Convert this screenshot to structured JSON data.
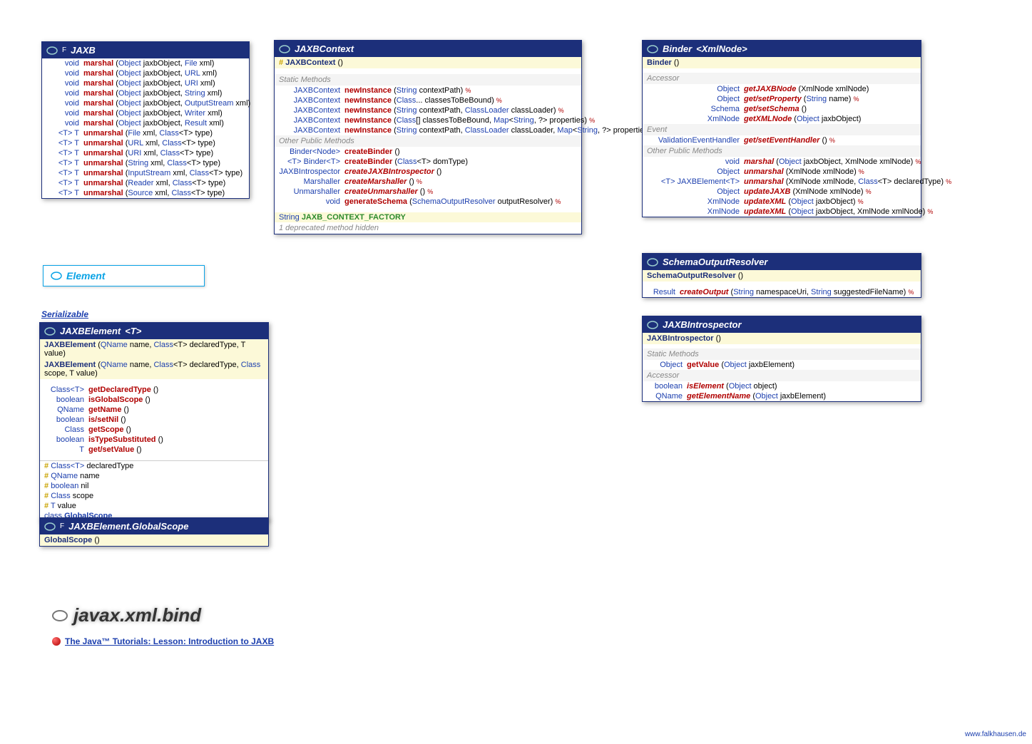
{
  "package": "javax.xml.bind",
  "tutorial": "The Java™ Tutorials: Lesson: Introduction to JAXB",
  "footer": "www.falkhausen.de",
  "element_label": "Element",
  "serializable_label": "Serializable",
  "jaxb": {
    "title_prefix": "F",
    "title": "JAXB",
    "rows": [
      {
        "ret": "void",
        "name": "marshal",
        "params": "(Object jaxbObject, File xml)",
        "link": [
          "Object",
          "File"
        ]
      },
      {
        "ret": "void",
        "name": "marshal",
        "params": "(Object jaxbObject, URL xml)",
        "link": [
          "Object",
          "URL"
        ]
      },
      {
        "ret": "void",
        "name": "marshal",
        "params": "(Object jaxbObject, URI xml)",
        "link": [
          "Object",
          "URI"
        ]
      },
      {
        "ret": "void",
        "name": "marshal",
        "params": "(Object jaxbObject, String xml)",
        "link": [
          "Object",
          "String"
        ]
      },
      {
        "ret": "void",
        "name": "marshal",
        "params": "(Object jaxbObject, OutputStream xml)",
        "link": [
          "Object",
          "OutputStream"
        ]
      },
      {
        "ret": "void",
        "name": "marshal",
        "params": "(Object jaxbObject, Writer xml)",
        "link": [
          "Object",
          "Writer"
        ]
      },
      {
        "ret": "void",
        "name": "marshal",
        "params": "(Object jaxbObject, Result xml)",
        "link": [
          "Object",
          "Result"
        ]
      },
      {
        "ret": "<T> T",
        "name": "unmarshal",
        "params": "(File xml, Class<T> type)",
        "link": [
          "File",
          "Class"
        ]
      },
      {
        "ret": "<T> T",
        "name": "unmarshal",
        "params": "(URL xml, Class<T> type)",
        "link": [
          "URL",
          "Class"
        ]
      },
      {
        "ret": "<T> T",
        "name": "unmarshal",
        "params": "(URI xml, Class<T> type)",
        "link": [
          "URI",
          "Class"
        ]
      },
      {
        "ret": "<T> T",
        "name": "unmarshal",
        "params": "(String xml, Class<T> type)",
        "link": [
          "String",
          "Class"
        ]
      },
      {
        "ret": "<T> T",
        "name": "unmarshal",
        "params": "(InputStream xml, Class<T> type)",
        "link": [
          "InputStream",
          "Class"
        ]
      },
      {
        "ret": "<T> T",
        "name": "unmarshal",
        "params": "(Reader xml, Class<T> type)",
        "link": [
          "Reader",
          "Class"
        ]
      },
      {
        "ret": "<T> T",
        "name": "unmarshal",
        "params": "(Source xml, Class<T> type)",
        "link": [
          "Source",
          "Class"
        ]
      }
    ]
  },
  "jaxbcontext": {
    "title": "JAXBContext",
    "ctor": "JAXBContext",
    "static_lbl": "Static Methods",
    "other_lbl": "Other Public Methods",
    "statics": [
      {
        "ret": "JAXBContext",
        "name": "newInstance",
        "params": "(String contextPath)"
      },
      {
        "ret": "JAXBContext",
        "name": "newInstance",
        "params": "(Class... classesToBeBound)"
      },
      {
        "ret": "JAXBContext",
        "name": "newInstance",
        "params": "(String contextPath, ClassLoader classLoader)"
      },
      {
        "ret": "JAXBContext",
        "name": "newInstance",
        "params": "(Class[] classesToBeBound, Map<String, ?> properties)"
      },
      {
        "ret": "JAXBContext",
        "name": "newInstance",
        "params": "(String contextPath, ClassLoader classLoader, Map<String, ?> properties)"
      }
    ],
    "others": [
      {
        "ret": "Binder<Node>",
        "name": "createBinder",
        "params": "()"
      },
      {
        "ret": "<T> Binder<T>",
        "name": "createBinder",
        "params": "(Class<T> domType)"
      },
      {
        "ret": "JAXBIntrospector",
        "name": "createJAXBIntrospector",
        "params": "()",
        "italic": true
      },
      {
        "ret": "Marshaller",
        "name": "createMarshaller",
        "params": "()",
        "italic": true,
        "thr": true
      },
      {
        "ret": "Unmarshaller",
        "name": "createUnmarshaller",
        "params": "()",
        "italic": true,
        "thr": true
      },
      {
        "ret": "void",
        "name": "generateSchema",
        "params": "(SchemaOutputResolver outputResolver)",
        "thr": true
      }
    ],
    "const_type": "String",
    "const_name": "JAXB_CONTEXT_FACTORY",
    "deprecated": "1 deprecated method hidden"
  },
  "binder": {
    "title": "Binder",
    "param": "<XmlNode>",
    "ctor": "Binder",
    "accessor_lbl": "Accessor",
    "event_lbl": "Event",
    "other_lbl": "Other Public Methods",
    "accessors": [
      {
        "ret": "Object",
        "name": "getJAXBNode",
        "params": "(XmlNode xmlNode)",
        "italic": true
      },
      {
        "ret": "Object",
        "name": "get/setProperty",
        "params": "(String name)",
        "italic": true,
        "thr": true
      },
      {
        "ret": "Schema",
        "name": "get/setSchema",
        "params": "()",
        "italic": true
      },
      {
        "ret": "XmlNode",
        "name": "getXMLNode",
        "params": "(Object jaxbObject)",
        "italic": true
      }
    ],
    "events": [
      {
        "ret": "ValidationEventHandler",
        "name": "get/setEventHandler",
        "params": "()",
        "italic": true,
        "thr": true
      }
    ],
    "others": [
      {
        "ret": "void",
        "name": "marshal",
        "params": "(Object jaxbObject, XmlNode xmlNode)",
        "italic": true,
        "thr": true
      },
      {
        "ret": "Object",
        "name": "unmarshal",
        "params": "(XmlNode xmlNode)",
        "italic": true,
        "thr": true
      },
      {
        "ret": "<T> JAXBElement<T>",
        "name": "unmarshal",
        "params": "(XmlNode xmlNode, Class<T> declaredType)",
        "italic": true,
        "thr": true
      },
      {
        "ret": "Object",
        "name": "updateJAXB",
        "params": "(XmlNode xmlNode)",
        "italic": true,
        "thr": true
      },
      {
        "ret": "XmlNode",
        "name": "updateXML",
        "params": "(Object jaxbObject)",
        "italic": true,
        "thr": true
      },
      {
        "ret": "XmlNode",
        "name": "updateXML",
        "params": "(Object jaxbObject, XmlNode xmlNode)",
        "italic": true,
        "thr": true
      }
    ]
  },
  "schemaout": {
    "title": "SchemaOutputResolver",
    "ctor": "SchemaOutputResolver",
    "row": {
      "ret": "Result",
      "name": "createOutput",
      "params": "(String namespaceUri, String suggestedFileName)",
      "italic": true,
      "thr": true
    }
  },
  "introspector": {
    "title": "JAXBIntrospector",
    "ctor": "JAXBIntrospector",
    "static_lbl": "Static Methods",
    "accessor_lbl": "Accessor",
    "statics": [
      {
        "ret": "Object",
        "name": "getValue",
        "params": "(Object jaxbElement)"
      }
    ],
    "accessors": [
      {
        "ret": "boolean",
        "name": "isElement",
        "params": "(Object object)",
        "italic": true
      },
      {
        "ret": "QName",
        "name": "getElementName",
        "params": "(Object jaxbElement)",
        "italic": true
      }
    ]
  },
  "jaxbelement": {
    "title": "JAXBElement",
    "param": "<T>",
    "ctors": [
      {
        "name": "JAXBElement",
        "params": "(QName name, Class<T> declaredType, T value)"
      },
      {
        "name": "JAXBElement",
        "params": "(QName name, Class<T> declaredType, Class scope, T value)"
      }
    ],
    "methods": [
      {
        "ret": "Class<T>",
        "name": "getDeclaredType",
        "params": "()"
      },
      {
        "ret": "boolean",
        "name": "isGlobalScope",
        "params": "()"
      },
      {
        "ret": "QName",
        "name": "getName",
        "params": "()"
      },
      {
        "ret": "boolean",
        "name": "is/setNil",
        "params": "()"
      },
      {
        "ret": "Class",
        "name": "getScope",
        "params": "()"
      },
      {
        "ret": "boolean",
        "name": "isTypeSubstituted",
        "params": "()"
      },
      {
        "ret": "T",
        "name": "get/setValue",
        "params": "()"
      }
    ],
    "fields": [
      {
        "pfx": "#",
        "type": "Class<T>",
        "name": "declaredType"
      },
      {
        "pfx": "#",
        "type": "QName",
        "name": "name"
      },
      {
        "pfx": "#",
        "type": "boolean",
        "name": "nil"
      },
      {
        "pfx": "#",
        "type": "Class",
        "name": "scope"
      },
      {
        "pfx": "#",
        "type": "T",
        "name": "value"
      },
      {
        "pfx": "",
        "type": "class",
        "name": "GlobalScope",
        "link": true
      }
    ]
  },
  "globalscope": {
    "title": "JAXBElement.GlobalScope",
    "ctor": "GlobalScope"
  }
}
